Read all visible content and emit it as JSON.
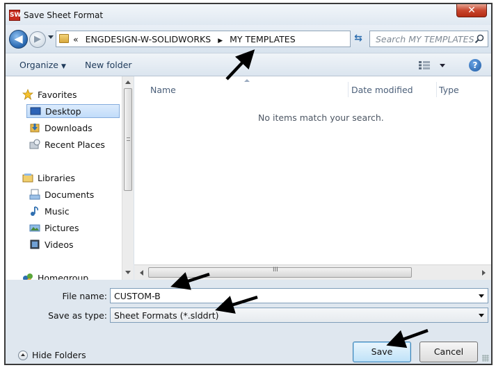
{
  "window": {
    "title": "Save Sheet Format",
    "app_icon_label": "SW",
    "close_glyph": "✕"
  },
  "navbar": {
    "path_prefix": "«",
    "path_segments": [
      "ENGDESIGN-W-SOLIDWORKS",
      "MY TEMPLATES"
    ],
    "path_separator": "▶",
    "search_placeholder": "Search MY TEMPLATES"
  },
  "commandbar": {
    "organize_label": "Organize",
    "new_folder_label": "New folder"
  },
  "navpane": {
    "items": [
      {
        "label": "Favorites",
        "icon": "star-icon"
      },
      {
        "label": "Desktop",
        "icon": "desktop-icon",
        "selected": true
      },
      {
        "label": "Downloads",
        "icon": "downloads-icon"
      },
      {
        "label": "Recent Places",
        "icon": "recent-places-icon"
      },
      {
        "label": "Libraries",
        "icon": "libraries-icon"
      },
      {
        "label": "Documents",
        "icon": "documents-icon"
      },
      {
        "label": "Music",
        "icon": "music-icon"
      },
      {
        "label": "Pictures",
        "icon": "pictures-icon"
      },
      {
        "label": "Videos",
        "icon": "videos-icon"
      },
      {
        "label": "Homegroup",
        "icon": "homegroup-icon"
      }
    ]
  },
  "filelist": {
    "columns": [
      "Name",
      "Date modified",
      "Type"
    ],
    "empty_message": "No items match your search.",
    "hscroll_grip": "III"
  },
  "fields": {
    "file_name_label": "File name:",
    "file_name_value": "CUSTOM-B",
    "save_type_label": "Save as type:",
    "save_type_value": "Sheet Formats (*.slddrt)"
  },
  "footer": {
    "hide_folders_label": "Hide Folders",
    "save_label": "Save",
    "cancel_label": "Cancel"
  },
  "colors": {
    "accent": "#2c6bb3",
    "annotation_arrow": "#000000",
    "close_button": "#c8462e"
  }
}
